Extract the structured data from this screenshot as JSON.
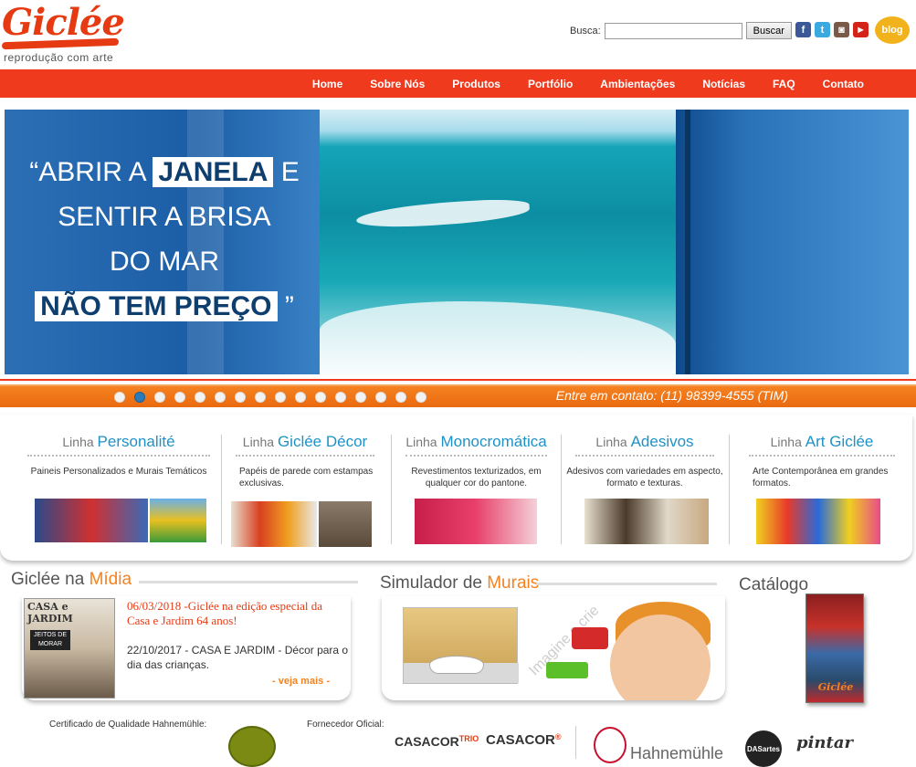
{
  "header": {
    "logo_text": "Giclée",
    "logo_tagline": "reprodução com arte",
    "search_label": "Busca:",
    "search_value": "",
    "search_button": "Buscar",
    "social": [
      "facebook-icon",
      "twitter-icon",
      "instagram-icon",
      "youtube-icon"
    ],
    "blog_label": "blog"
  },
  "nav": {
    "items": [
      "Home",
      "Sobre Nós",
      "Produtos",
      "Portfólio",
      "Ambientações",
      "Notícias",
      "FAQ",
      "Contato"
    ]
  },
  "hero": {
    "line1_a": "“ABRIR A",
    "line1_hl": "JANELA",
    "line1_b": "E",
    "line2": "SENTIR A BRISA",
    "line3": "DO MAR",
    "line4_hl": "NÃO TEM PREÇO",
    "line4_b": "”"
  },
  "slider": {
    "dot_count": 16,
    "active_index": 1,
    "contact": "Entre em contato: (11) 98399-4555 (TIM)"
  },
  "lines": [
    {
      "prefix": "Linha",
      "name": "Personalité",
      "desc": "Paineis Personalizados e Murais Temáticos"
    },
    {
      "prefix": "Linha",
      "name": "Giclée Décor",
      "desc": "Papéis de parede com estampas exclusivas."
    },
    {
      "prefix": "Linha",
      "name": "Monocromática",
      "desc": "Revestimentos texturizados, em qualquer cor do pantone."
    },
    {
      "prefix": "Linha",
      "name": "Adesivos",
      "desc": "Adesivos com variedades em aspecto, formato e texturas."
    },
    {
      "prefix": "Linha",
      "name": "Art Giclée",
      "desc": "Arte Contemporânea em grandes formatos."
    }
  ],
  "media": {
    "title_a": "Giclée na",
    "title_b": "Mídia",
    "magazine_title": "CASA e JARDIM",
    "magazine_box": "JEITOS DE MORAR",
    "news1": "06/03/2018 -Giclée na edição especial da Casa e Jardim 64 anos!",
    "news2": "22/10/2017 - CASA E JARDIM - Décor para o dia das crianças.",
    "more": "- veja mais -"
  },
  "simulator": {
    "title_a": "Simulador de",
    "title_b": "Murais",
    "tagline": "Imagine e crie"
  },
  "catalog": {
    "title": "Catálogo",
    "brand": "Giclée"
  },
  "footer": {
    "cert_label": "Certificado de Qualidade Hahnemühle:",
    "supplier_label": "Fornecedor Oficial:",
    "brand1": "CASACOR",
    "brand1_sup": "TRIO",
    "brand2": "CASACOR",
    "brand2_sup": "®",
    "brand3": "Hahnemühle",
    "brand4": "DASartes",
    "brand5": "pintar"
  },
  "colors": {
    "accent_red": "#ef3a1e",
    "accent_orange": "#f58220",
    "link_blue": "#1e92c6"
  }
}
